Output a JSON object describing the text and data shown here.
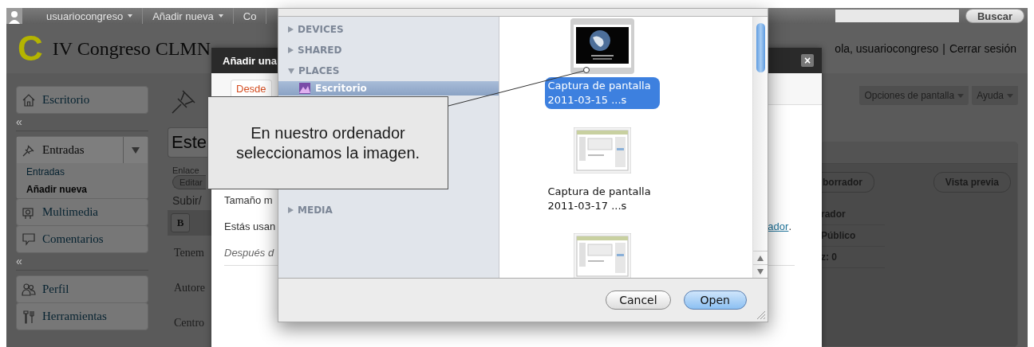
{
  "admin_bar": {
    "menus": [
      {
        "label": "usuariocongreso",
        "dropdown": true
      },
      {
        "label": "Añadir nueva",
        "dropdown": true
      },
      {
        "label": "Co",
        "dropdown": false
      }
    ],
    "search_button": "Buscar"
  },
  "header": {
    "logo": "C",
    "site_title": "IV Congreso CLMN",
    "greeting": "ola, usuariocongreso",
    "separator": "|",
    "logout": "Cerrar sesión"
  },
  "sidebar": {
    "sections": [
      {
        "items": [
          {
            "label": "Escritorio",
            "kind": "home",
            "expanded": false
          }
        ]
      },
      {
        "items": [
          {
            "label": "Entradas",
            "kind": "pin",
            "expanded": true,
            "children": [
              {
                "label": "Entradas",
                "selected": false
              },
              {
                "label": "Añadir nueva",
                "selected": true
              }
            ]
          },
          {
            "label": "Multimedia",
            "kind": "media",
            "expanded": false
          },
          {
            "label": "Comentarios",
            "kind": "comment",
            "expanded": false
          }
        ]
      },
      {
        "items": [
          {
            "label": "Perfil",
            "kind": "users",
            "expanded": false
          },
          {
            "label": "Herramientas",
            "kind": "tools",
            "expanded": false
          }
        ]
      }
    ],
    "collapse_glyphs": [
      "«",
      "«"
    ]
  },
  "editor": {
    "title": "Este",
    "permalink_label": "Enlace",
    "edit_button": "Editar",
    "upload_label": "Subir/",
    "format_buttons": [
      "B"
    ],
    "body_lines": [
      "Tenem",
      "Autore",
      "Centro"
    ]
  },
  "screen_meta": {
    "buttons": [
      "Opciones de pantalla",
      "Ayuda"
    ]
  },
  "publish_box": {
    "draft_button": "borrador",
    "preview_button": "Vista previa",
    "status_lines": [
      "rador",
      "Público",
      "z: 0"
    ]
  },
  "media_dialog": {
    "title": "Añadir una",
    "close": "×",
    "tabs": [
      {
        "label": "Desde",
        "selected": true
      }
    ],
    "lines": [
      {
        "text": "Tamaño m",
        "italic": false
      },
      {
        "text": "Estás usan",
        "italic": false,
        "link": "ador",
        "suffix": "."
      },
      {
        "text": "Después d",
        "italic": true
      }
    ]
  },
  "file_dialog": {
    "sidebar": [
      {
        "title": "DEVICES",
        "expanded": false
      },
      {
        "title": "SHARED",
        "expanded": false
      },
      {
        "title": "PLACES",
        "expanded": true,
        "items": [
          {
            "label": "Escritorio",
            "selected": true
          }
        ]
      },
      {
        "title": "MEDIA",
        "expanded": false
      }
    ],
    "files": [
      {
        "name_lines": [
          "Captura de pantalla",
          "2011-03-15 ...s"
        ],
        "selected": true,
        "kind": "dark"
      },
      {
        "name_lines": [
          "Captura de pantalla",
          "2011-03-17 ...s"
        ],
        "selected": false,
        "kind": "light"
      },
      {
        "selected": false,
        "kind": "light"
      }
    ],
    "buttons": [
      {
        "label": "Cancel",
        "default": false
      },
      {
        "label": "Open",
        "default": true
      }
    ]
  },
  "callout": {
    "text": "En nuestro ordenador seleccionamos la imagen."
  }
}
